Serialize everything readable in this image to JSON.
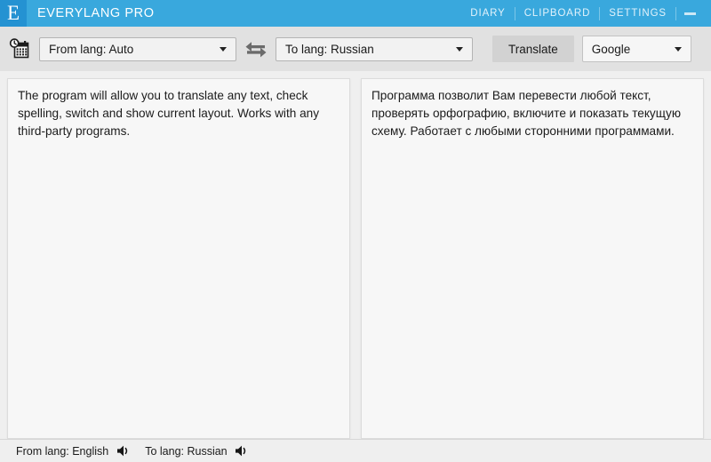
{
  "window": {
    "logo_glyph": "E",
    "title": "EVERYLANG PRO",
    "menu": [
      {
        "label": "DIARY",
        "name": "diary"
      },
      {
        "label": "CLIPBOARD",
        "name": "clipboard"
      },
      {
        "label": "SETTINGS",
        "name": "settings"
      }
    ],
    "minimize_label": "—"
  },
  "toolbar": {
    "history_icon": "calendar-clock-icon",
    "from_lang": {
      "value": "From lang: Auto",
      "icon": "chevron-down-icon"
    },
    "swap_icon": "swap-arrows-icon",
    "to_lang": {
      "value": "To lang: Russian",
      "icon": "chevron-down-icon"
    },
    "translate_label": "Translate",
    "engine": {
      "value": "Google",
      "icon": "chevron-down-icon"
    }
  },
  "panels": {
    "source": {
      "text": "The program will allow you to translate any text, check spelling, switch and show current layout. Works with any third-party programs."
    },
    "target": {
      "text": "Программа позволит Вам перевести любой текст, проверять орфографию, включите и показать текущую схему. Работает с любыми сторонними программами."
    }
  },
  "statusbar": {
    "from_lang": "From lang: English",
    "to_lang": "To lang: Russian",
    "speaker_icon": "speaker-icon"
  },
  "colors": {
    "titlebar": "#39a8dd",
    "logo": "#2492d2",
    "toolbar": "#e1e1e1",
    "panel": "#f7f7f7",
    "background": "#efefef",
    "text": "#1a1a1a"
  }
}
